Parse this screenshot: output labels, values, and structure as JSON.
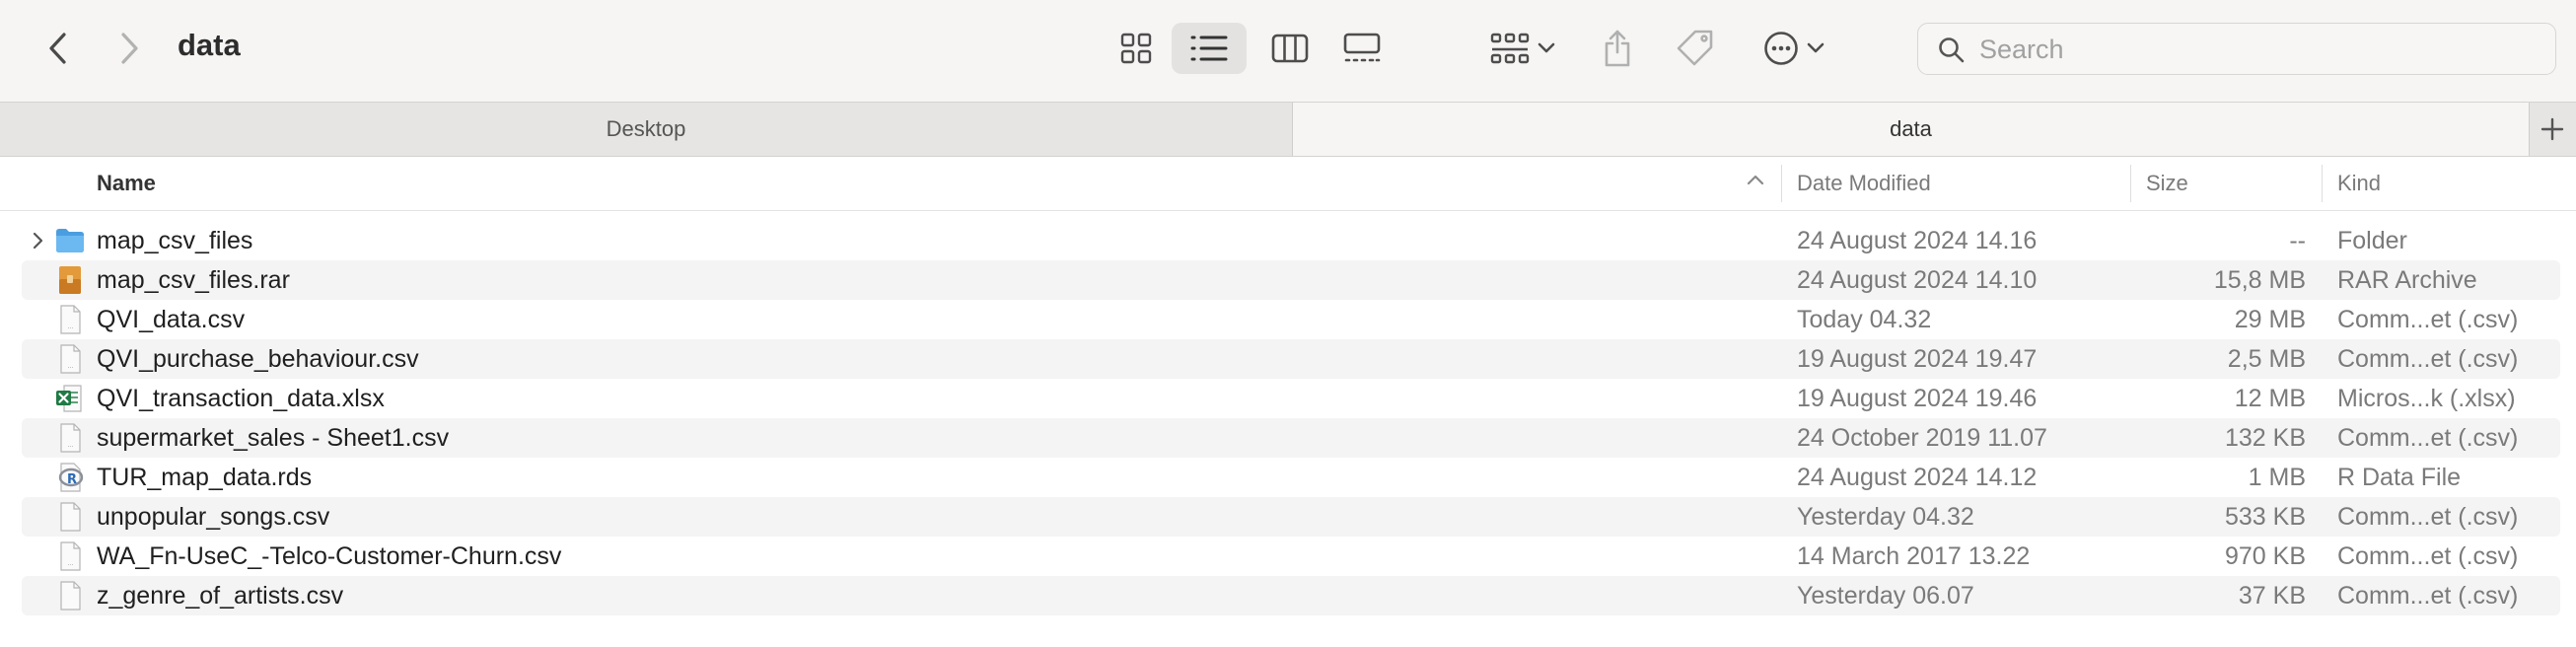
{
  "window": {
    "title": "data"
  },
  "toolbar": {
    "search_placeholder": "Search"
  },
  "tabs": [
    {
      "label": "Desktop"
    },
    {
      "label": "data"
    }
  ],
  "columns": {
    "name": "Name",
    "date": "Date Modified",
    "size": "Size",
    "kind": "Kind"
  },
  "files": [
    {
      "name": "map_csv_files",
      "date": "24 August 2024 14.16",
      "size": "--",
      "kind": "Folder",
      "icon": "folder-icon"
    },
    {
      "name": "map_csv_files.rar",
      "date": "24 August 2024 14.10",
      "size": "15,8 MB",
      "kind": "RAR Archive",
      "icon": "archive-icon"
    },
    {
      "name": "QVI_data.csv",
      "date": "Today 04.32",
      "size": "29 MB",
      "kind": "Comm...et (.csv)",
      "icon": "csv-file-icon"
    },
    {
      "name": "QVI_purchase_behaviour.csv",
      "date": "19 August 2024 19.47",
      "size": "2,5 MB",
      "kind": "Comm...et (.csv)",
      "icon": "csv-file-icon"
    },
    {
      "name": "QVI_transaction_data.xlsx",
      "date": "19 August 2024 19.46",
      "size": "12 MB",
      "kind": "Micros...k (.xlsx)",
      "icon": "excel-file-icon"
    },
    {
      "name": "supermarket_sales - Sheet1.csv",
      "date": "24 October 2019 11.07",
      "size": "132 KB",
      "kind": "Comm...et (.csv)",
      "icon": "csv-file-icon"
    },
    {
      "name": "TUR_map_data.rds",
      "date": "24 August 2024 14.12",
      "size": "1 MB",
      "kind": "R Data File",
      "icon": "rds-file-icon"
    },
    {
      "name": "unpopular_songs.csv",
      "date": "Yesterday 04.32",
      "size": "533 KB",
      "kind": "Comm...et (.csv)",
      "icon": "csv-file-icon"
    },
    {
      "name": "WA_Fn-UseC_-Telco-Customer-Churn.csv",
      "date": "14 March 2017 13.22",
      "size": "970 KB",
      "kind": "Comm...et (.csv)",
      "icon": "csv-file-icon"
    },
    {
      "name": "z_genre_of_artists.csv",
      "date": "Yesterday 06.07",
      "size": "37 KB",
      "kind": "Comm...et (.csv)",
      "icon": "csv-file-icon"
    }
  ],
  "colors": {
    "folder": "#5aa8e6",
    "archive": "#e39a3b",
    "excel": "#1f7a43",
    "stripe": "#f4f4f4"
  }
}
